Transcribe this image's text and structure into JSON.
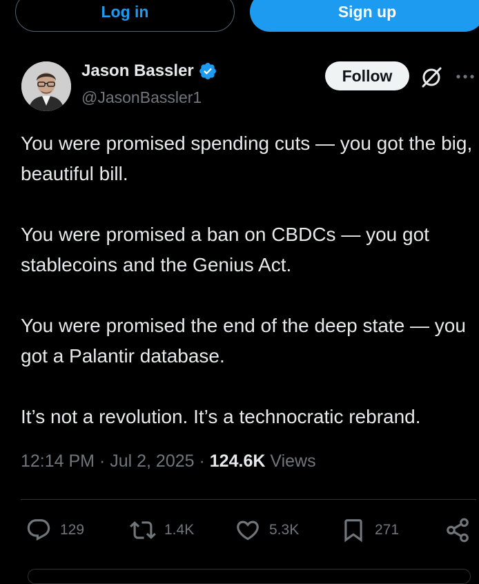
{
  "header": {
    "login_label": "Log in",
    "signup_label": "Sign up"
  },
  "author": {
    "name": "Jason Bassler",
    "handle": "@JasonBassler1",
    "verified": true,
    "follow_label": "Follow"
  },
  "tweet": {
    "paragraphs": [
      "You were promised spending cuts — you got the big, beautiful bill.",
      "You were promised a ban on CBDCs — you got stablecoins and the Genius Act.",
      "You were promised the end of the deep state — you got a Palantir database.",
      "It’s not a revolution. It’s a technocratic rebrand."
    ]
  },
  "meta": {
    "time": "12:14 PM",
    "separator": " · ",
    "date": "Jul 2, 2025",
    "views_count": "124.6K",
    "views_label": "Views"
  },
  "actions": {
    "replies": "129",
    "reposts": "1.4K",
    "likes": "5.3K",
    "bookmarks": "271"
  },
  "icons": {
    "verified": "verified-badge-icon",
    "grok": "grok-icon",
    "more": "more-icon",
    "reply": "reply-icon",
    "repost": "repost-icon",
    "like": "heart-icon",
    "bookmark": "bookmark-icon",
    "share": "share-icon"
  },
  "colors": {
    "accent": "#1d9bf0",
    "background": "#000000",
    "text": "#e7e9ea",
    "muted": "#71767b"
  }
}
